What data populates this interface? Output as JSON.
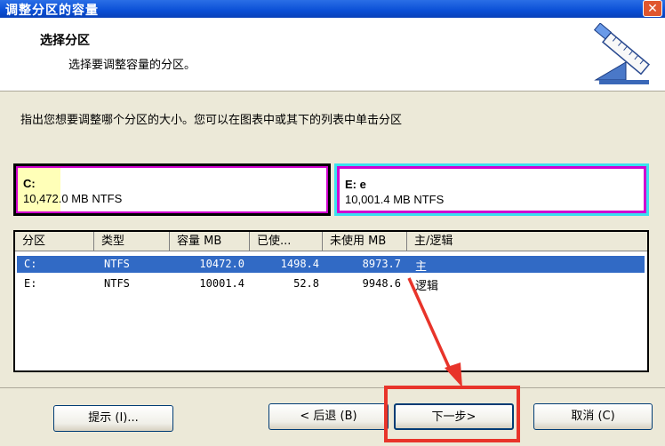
{
  "window": {
    "title": "调整分区的容量",
    "close_glyph": "✕"
  },
  "header": {
    "title": "选择分区",
    "subtitle": "选择要调整容量的分区。"
  },
  "instruction": "指出您想要调整哪个分区的大小。您可以在图表中或其下的列表中单击分区",
  "partitions_map": [
    {
      "label": "C:",
      "info": "10,472.0 MB   NTFS"
    },
    {
      "label": "E:  e",
      "info": "10,001.4 MB   NTFS"
    }
  ],
  "list": {
    "columns": [
      "分区",
      "类型",
      "容量 MB",
      "已使...",
      "未使用 MB",
      "主/逻辑"
    ],
    "rows": [
      {
        "partition": "C:",
        "type": "NTFS",
        "capacity": "10472.0",
        "used": "1498.4",
        "unused": "8973.7",
        "kind": "主",
        "selected": true
      },
      {
        "partition": "E:",
        "type": "NTFS",
        "capacity": "10001.4",
        "used": "52.8",
        "unused": "9948.6",
        "kind": "逻辑",
        "selected": false
      }
    ]
  },
  "buttons": {
    "hint": "提示 (I)...",
    "back": "< 后退 (B)",
    "next": "下一步>",
    "cancel": "取消 (C)"
  },
  "colors": {
    "selection": "#316ac5",
    "highlight": "#e8342a",
    "partition_border": "#d000d0",
    "logical_border": "#3ae0f0"
  }
}
